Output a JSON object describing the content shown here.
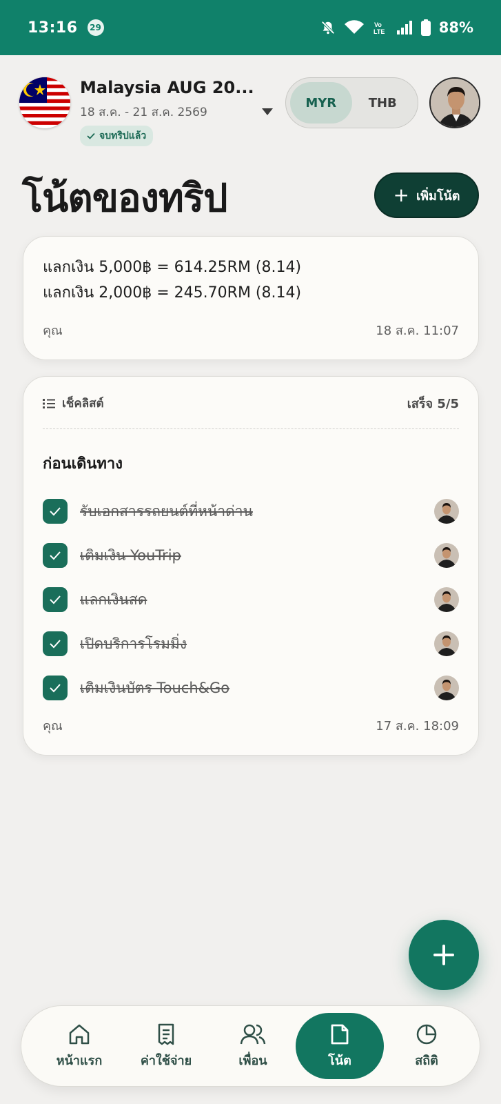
{
  "status_bar": {
    "time": "13:16",
    "notification_count": "29",
    "battery": "88%"
  },
  "trip": {
    "title": "Malaysia AUG 20...",
    "dates": "18 ส.ค. - 21 ส.ค. 2569",
    "badge": "จบทริปแล้ว"
  },
  "currency": {
    "options": [
      "MYR",
      "THB"
    ],
    "selected": "MYR"
  },
  "page": {
    "title": "โน้ตของทริป",
    "add_note_label": "เพิ่มโน้ต"
  },
  "notes": [
    {
      "lines": [
        "แลกเงิน 5,000฿ = 614.25RM (8.14)",
        "แลกเงิน 2,000฿ = 245.70RM (8.14)"
      ],
      "author": "คุณ",
      "timestamp": "18 ส.ค. 11:07"
    }
  ],
  "checklist": {
    "label": "เช็คลิสต์",
    "progress": "เสร็จ 5/5",
    "section_title": "ก่อนเดินทาง",
    "items": [
      {
        "text": "รับเอกสารรถยนต์ที่หน้าด่าน",
        "checked": true
      },
      {
        "text": "เติมเงิน YouTrip",
        "checked": true
      },
      {
        "text": "แลกเงินสด",
        "checked": true
      },
      {
        "text": "เปิดบริการโรมมิ่ง",
        "checked": true
      },
      {
        "text": "เติมเงินบัตร Touch&Go",
        "checked": true
      }
    ],
    "author": "คุณ",
    "timestamp": "17 ส.ค. 18:09"
  },
  "nav": {
    "items": [
      {
        "label": "หน้าแรก",
        "icon": "home-icon"
      },
      {
        "label": "ค่าใช้จ่าย",
        "icon": "receipt-icon"
      },
      {
        "label": "เพื่อน",
        "icon": "users-icon"
      },
      {
        "label": "โน้ต",
        "icon": "note-icon"
      },
      {
        "label": "สถิติ",
        "icon": "pie-chart-icon"
      }
    ],
    "active": "โน้ต"
  },
  "colors": {
    "brand": "#10816a",
    "dark_button": "#0f3f34",
    "checkbox": "#1a6e5a",
    "background": "#f1f0ee"
  }
}
